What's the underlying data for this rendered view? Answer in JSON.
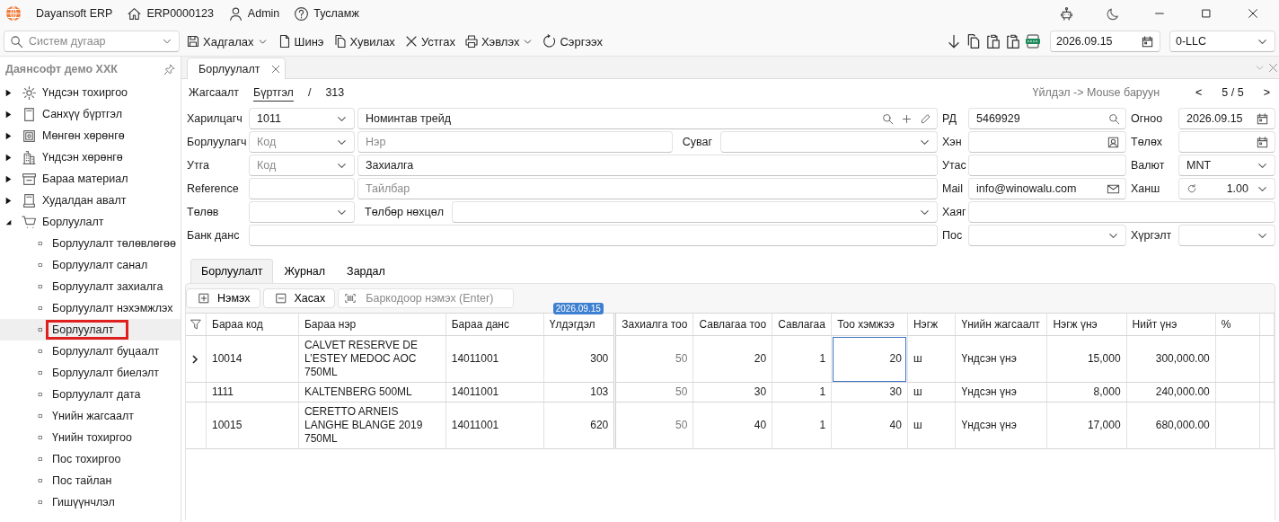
{
  "app_bar": {
    "title": "Dayansoft ERP",
    "document": "ERP0000123",
    "user": "Admin",
    "help": "Тусламж"
  },
  "toolbar": {
    "search": {
      "placeholder": "Систем дугаар"
    },
    "actions": [
      {
        "label": "Хадгалах",
        "dropdown": true
      },
      {
        "label": "Шинэ",
        "dropdown": false
      },
      {
        "label": "Хувилах",
        "dropdown": false
      },
      {
        "label": "Устгах",
        "dropdown": false
      },
      {
        "label": "Хэвлэх",
        "dropdown": true
      },
      {
        "label": "Сэргээх",
        "dropdown": false
      }
    ],
    "date": "2026.09.15",
    "company": "0-LLC"
  },
  "sidebar": {
    "title": "Даянсофт демо ХХК",
    "items": [
      {
        "label": "Үндсэн тохиргоо",
        "expanded": false
      },
      {
        "label": "Санхүү бүртгэл",
        "expanded": false
      },
      {
        "label": "Мөнгөн хөрөнгө",
        "expanded": false
      },
      {
        "label": "Үндсэн хөрөнгө",
        "expanded": false
      },
      {
        "label": "Бараа материал",
        "expanded": false
      },
      {
        "label": "Худалдан авалт",
        "expanded": false
      },
      {
        "label": "Борлуулалт",
        "expanded": true,
        "children": [
          {
            "label": "Борлуулалт төлөвлөгөө",
            "selected": false
          },
          {
            "label": "Борлуулалт санал",
            "selected": false
          },
          {
            "label": "Борлуулалт захиалга",
            "selected": false
          },
          {
            "label": "Борлуулалт нэхэмжлэх",
            "selected": false
          },
          {
            "label": "Борлуулалт",
            "selected": true
          },
          {
            "label": "Борлуулалт буцаалт",
            "selected": false
          },
          {
            "label": "Борлуулалт биелэлт",
            "selected": false
          },
          {
            "label": "Борлуулалт дата",
            "selected": false
          },
          {
            "label": "Үнийн жагсаалт",
            "selected": false
          },
          {
            "label": "Үнийн тохиргоо",
            "selected": false
          },
          {
            "label": "Пос тохиргоо",
            "selected": false
          },
          {
            "label": "Пос тайлан",
            "selected": false
          },
          {
            "label": "Гишүүнчлэл",
            "selected": false
          }
        ]
      }
    ]
  },
  "document_tabs": [
    {
      "label": "Борлуулалт",
      "selected": true
    }
  ],
  "view_tabs": [
    {
      "label": "Жагсаалт",
      "selected": false
    },
    {
      "label": "Бүртгэл",
      "selected": true
    }
  ],
  "separator": "/",
  "record_id": "313",
  "hint": "Үйлдэл -> Mouse баруун",
  "pager": {
    "prev": "<",
    "position": "5 / 5",
    "next": ">"
  },
  "form": [
    {
      "label": "Харилцагч",
      "code": {
        "kind": "combo",
        "value": "1011"
      },
      "name": {
        "kind": "lookup",
        "value": "Номинтав трейд"
      },
      "mid_label": "РД",
      "mid": {
        "kind": "search",
        "value": "5469929"
      },
      "right_label": "Огноо",
      "right": {
        "kind": "date",
        "value": "2026.09.15"
      }
    },
    {
      "label": "Борлуулагч",
      "code": {
        "kind": "combo",
        "placeholder": "Код"
      },
      "name": {
        "kind": "text",
        "placeholder": "Нэр"
      },
      "inner_label": "Суваг",
      "inner": {
        "kind": "combo"
      },
      "mid_label": "Хэн",
      "mid": {
        "kind": "person"
      },
      "right_label": "Төлөх",
      "right": {
        "kind": "date"
      }
    },
    {
      "label": "Утга",
      "code": {
        "kind": "combo",
        "placeholder": "Код"
      },
      "name": {
        "kind": "text",
        "value": "Захиалга"
      },
      "mid_label": "Утас",
      "mid": {
        "kind": "text"
      },
      "right_label": "Валют",
      "right": {
        "kind": "combo",
        "value": "MNT"
      }
    },
    {
      "label": "Reference",
      "code": {
        "kind": "text"
      },
      "name": {
        "kind": "text",
        "placeholder": "Тайлбар"
      },
      "mid_label": "Mail",
      "mid": {
        "kind": "mail",
        "value": "info@winowalu.com"
      },
      "right_label": "Ханш",
      "right": {
        "kind": "rate",
        "value": "1.00"
      }
    },
    {
      "label": "Төлөв",
      "code": {
        "kind": "combo"
      },
      "inner_label": "Төлбөр нөхцөл",
      "inner": {
        "kind": "combo"
      },
      "mid_label": "Хаяг",
      "mid": {
        "kind": "text"
      }
    },
    {
      "label": "Банк данс",
      "name": {
        "kind": "text"
      },
      "mid_label": "Пос",
      "mid": {
        "kind": "combo"
      },
      "right_label": "Хүргэлт",
      "right": {
        "kind": "combo"
      }
    }
  ],
  "detail_tabs": [
    {
      "label": "Борлуулалт",
      "selected": true
    },
    {
      "label": "Журнал",
      "selected": false
    },
    {
      "label": "Зардал",
      "selected": false
    }
  ],
  "detail_toolbar": {
    "add": "Нэмэх",
    "remove": "Хасах",
    "barcode": {
      "placeholder": "Баркодоор нэмэх (Enter)"
    }
  },
  "grid": {
    "columns": [
      {
        "label": "Бараа код",
        "disabled": false,
        "focused": false
      },
      {
        "label": "Бараа нэр",
        "disabled": false,
        "focused": false
      },
      {
        "label": "Бараа данс",
        "disabled": false,
        "focused": false
      },
      {
        "label": "Үлдэгдэл",
        "disabled": false,
        "focused": false,
        "badge": "2026.09.15"
      },
      {
        "label": "Захиалга тоо",
        "disabled": true,
        "focused": false
      },
      {
        "label": "Савлагаа тоо",
        "disabled": false,
        "focused": false
      },
      {
        "label": "Савлагаа",
        "disabled": false,
        "focused": false
      },
      {
        "label": "Тоо хэмжээ",
        "disabled": false,
        "focused": true
      },
      {
        "label": "Нэгж",
        "disabled": false,
        "focused": false
      },
      {
        "label": "Үнийн жагсаалт",
        "disabled": false,
        "focused": false
      },
      {
        "label": "Нэгж үнэ",
        "disabled": false,
        "focused": false
      },
      {
        "label": "Нийт үнэ",
        "disabled": false,
        "focused": false
      },
      {
        "label": "%",
        "disabled": false,
        "focused": false
      }
    ],
    "rows": [
      {
        "current": true,
        "cells": [
          "10014",
          "CALVET RESERVE DE L’ESTEY MEDOC AOC 750ML",
          "14011001",
          "300",
          "50",
          "20",
          "1",
          "20",
          "ш",
          "Үндсэн үнэ",
          "15,000",
          "300,000.00"
        ]
      },
      {
        "current": false,
        "cells": [
          "1111",
          "KALTENBERG 500ML",
          "14011001",
          "103",
          "50",
          "30",
          "1",
          "30",
          "ш",
          "Үндсэн үнэ",
          "8,000",
          "240,000.00"
        ]
      },
      {
        "current": false,
        "cells": [
          "10015",
          "CERETTO ARNEIS LANGHE BLANGE 2019 750ML",
          "14011001",
          "620",
          "50",
          "40",
          "1",
          "40",
          "ш",
          "Үндсэн үнэ",
          "17,000",
          "680,000.00"
        ]
      }
    ]
  }
}
